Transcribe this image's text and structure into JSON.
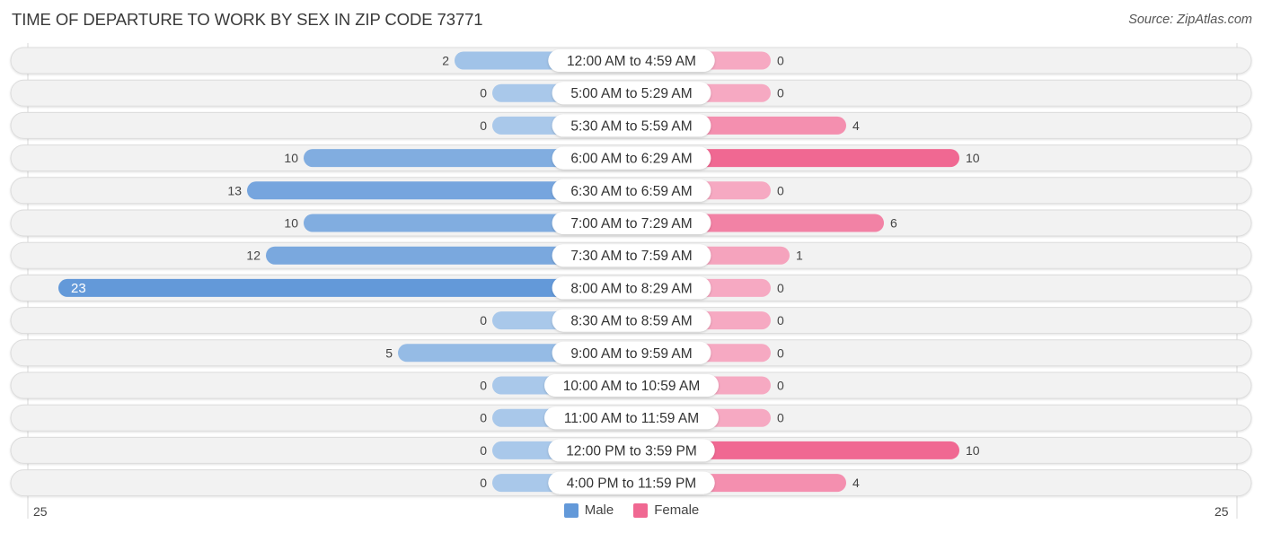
{
  "header": {
    "title": "TIME OF DEPARTURE TO WORK BY SEX IN ZIP CODE 73771",
    "source": "Source: ZipAtlas.com"
  },
  "colors": {
    "male_strong": "#6399d9",
    "male_light": "#a9c8ea",
    "female_strong": "#f06892",
    "female_light": "#f6a9c2",
    "row_bg": "#f2f2f2",
    "row_border": "#dcdcdc"
  },
  "chart_data": {
    "type": "bar",
    "orientation": "horizontal-diverging",
    "title": "TIME OF DEPARTURE TO WORK BY SEX IN ZIP CODE 73771",
    "categories": [
      "12:00 AM to 4:59 AM",
      "5:00 AM to 5:29 AM",
      "5:30 AM to 5:59 AM",
      "6:00 AM to 6:29 AM",
      "6:30 AM to 6:59 AM",
      "7:00 AM to 7:29 AM",
      "7:30 AM to 7:59 AM",
      "8:00 AM to 8:29 AM",
      "8:30 AM to 8:59 AM",
      "9:00 AM to 9:59 AM",
      "10:00 AM to 10:59 AM",
      "11:00 AM to 11:59 AM",
      "12:00 PM to 3:59 PM",
      "4:00 PM to 11:59 PM"
    ],
    "series": [
      {
        "name": "Male",
        "values": [
          2,
          0,
          0,
          10,
          13,
          10,
          12,
          23,
          0,
          5,
          0,
          0,
          0,
          0
        ]
      },
      {
        "name": "Female",
        "values": [
          0,
          0,
          4,
          10,
          0,
          6,
          1,
          0,
          0,
          0,
          0,
          0,
          10,
          4
        ]
      }
    ],
    "xlim": [
      -25,
      25
    ],
    "axis_labels": {
      "left": "25",
      "right": "25"
    },
    "legend": {
      "position": "bottom-center",
      "entries": [
        "Male",
        "Female"
      ]
    },
    "grid": false
  }
}
